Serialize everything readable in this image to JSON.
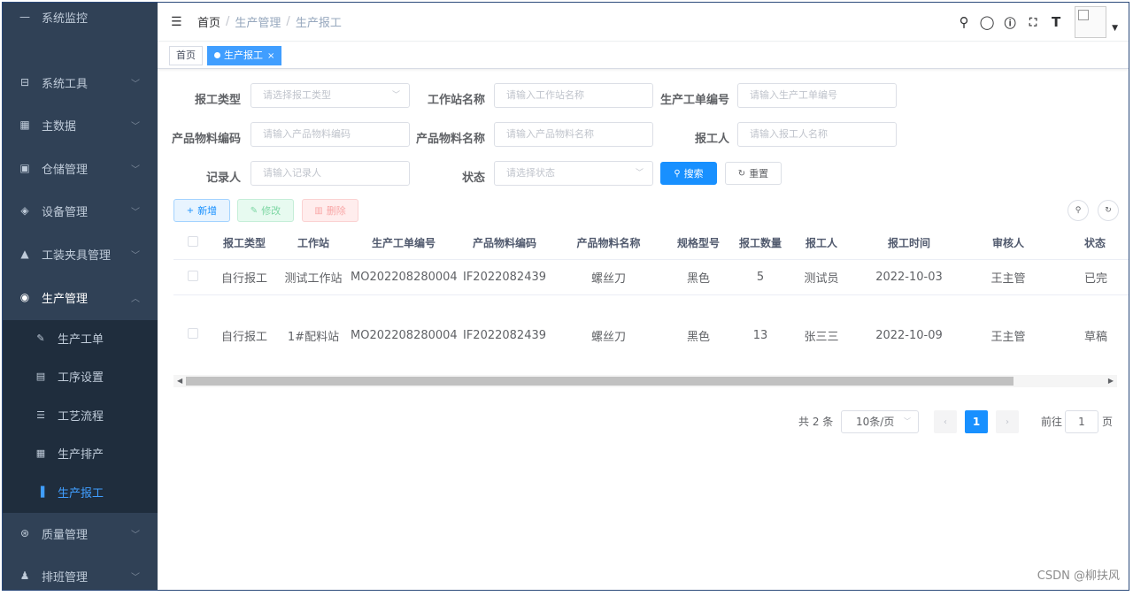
{
  "sidebar": {
    "partial_top": "系统监控",
    "items": [
      {
        "label": "系统工具",
        "icon": "toolbox-icon",
        "glyph": "⊟"
      },
      {
        "label": "主数据",
        "icon": "grid-icon",
        "glyph": "▦"
      },
      {
        "label": "仓储管理",
        "icon": "warehouse-icon",
        "glyph": "▣"
      },
      {
        "label": "设备管理",
        "icon": "layers-icon",
        "glyph": "◈"
      },
      {
        "label": "工装夹具管理",
        "icon": "lock-icon",
        "glyph": "▲"
      },
      {
        "label": "生产管理",
        "icon": "eye-icon",
        "glyph": "◉"
      }
    ],
    "subitems": [
      {
        "label": "生产工单",
        "icon": "edit-icon",
        "glyph": "✎"
      },
      {
        "label": "工序设置",
        "icon": "image-icon",
        "glyph": "▤"
      },
      {
        "label": "工艺流程",
        "icon": "list-icon",
        "glyph": "☰"
      },
      {
        "label": "生产排产",
        "icon": "calendar-icon",
        "glyph": "▦"
      },
      {
        "label": "生产报工",
        "icon": "bar-chart-icon",
        "glyph": "▐"
      }
    ],
    "bottom_items": [
      {
        "label": "质量管理",
        "icon": "quality-icon",
        "glyph": "⊛"
      },
      {
        "label": "排班管理",
        "icon": "people-icon",
        "glyph": "♟"
      }
    ]
  },
  "navbar": {
    "breadcrumb": [
      "首页",
      "生产管理",
      "生产报工"
    ],
    "separator": "/"
  },
  "tags": {
    "home": "首页",
    "active": "生产报工",
    "close": "×"
  },
  "search": {
    "report_type_label": "报工类型",
    "report_type_placeholder": "请选择报工类型",
    "workstation_label": "工作站名称",
    "workstation_placeholder": "请输入工作站名称",
    "workorder_label": "生产工单编号",
    "workorder_placeholder": "请输入生产工单编号",
    "item_code_label": "产品物料编码",
    "item_code_placeholder": "请输入产品物料编码",
    "item_name_label": "产品物料名称",
    "item_name_placeholder": "请输入产品物料名称",
    "reporter_label": "报工人",
    "reporter_placeholder": "请输入报工人名称",
    "recorder_label": "记录人",
    "recorder_placeholder": "请输入记录人",
    "status_label": "状态",
    "status_placeholder": "请选择状态",
    "search_btn": "搜索",
    "reset_btn": "重置"
  },
  "toolbar": {
    "add": "新增",
    "edit": "修改",
    "delete": "删除"
  },
  "table": {
    "columns": [
      "报工类型",
      "工作站",
      "生产工单编号",
      "产品物料编码",
      "产品物料名称",
      "规格型号",
      "报工数量",
      "报工人",
      "报工时间",
      "审核人",
      "状态"
    ],
    "rows": [
      [
        "自行报工",
        "测试工作站",
        "MO202208280004",
        "IF2022082439",
        "螺丝刀",
        "黑色",
        "5",
        "测试员",
        "2022-10-03",
        "王主管",
        "已完"
      ],
      [
        "自行报工",
        "1#配料站",
        "MO202208280004",
        "IF2022082439",
        "螺丝刀",
        "黑色",
        "13",
        "张三三",
        "2022-10-09",
        "王主管",
        "草稿"
      ]
    ]
  },
  "pagination": {
    "total": "共 2 条",
    "page_size": "10条/页",
    "current_page": "1",
    "goto_label": "前往",
    "goto_value": "1",
    "page_suffix": "页"
  },
  "watermark": "CSDN @柳扶风"
}
